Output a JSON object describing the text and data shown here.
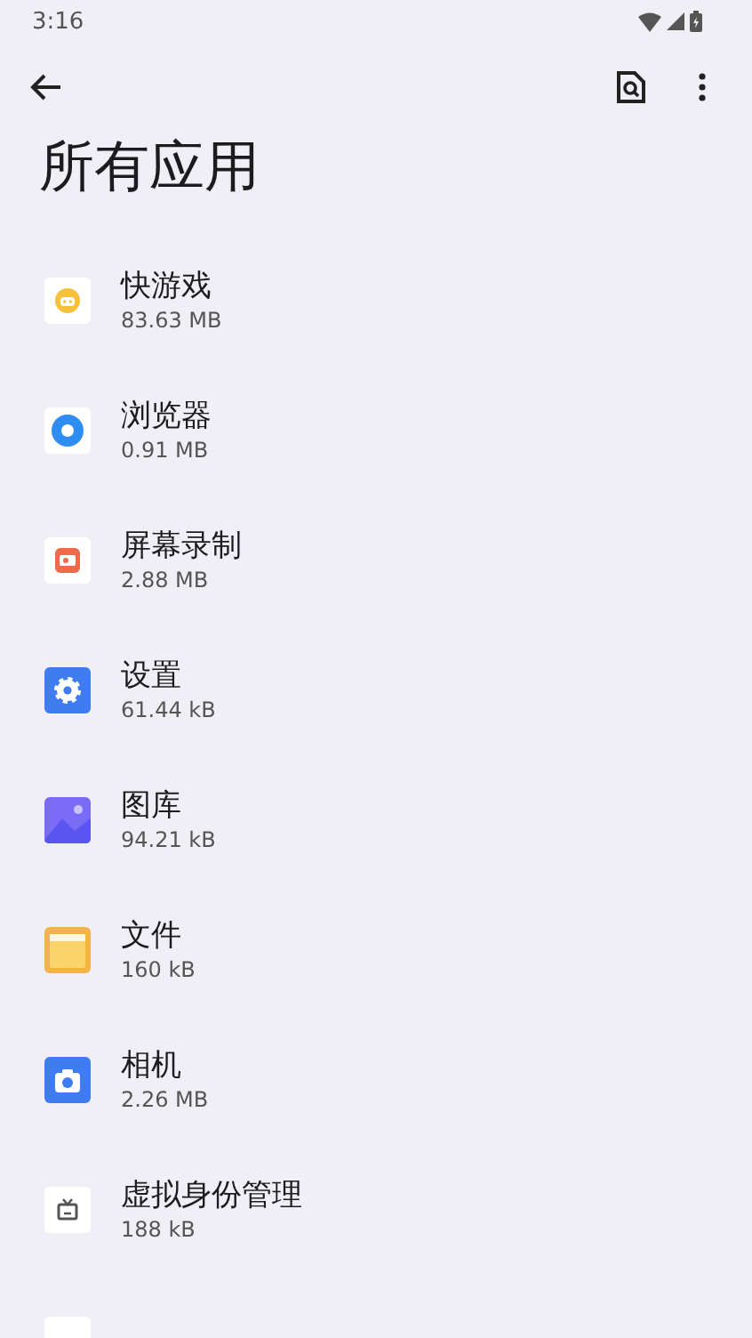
{
  "status_bar": {
    "time": "3:16"
  },
  "toolbar": {
    "title": "所有应用"
  },
  "apps": [
    {
      "name": "快游戏",
      "size": "83.63 MB",
      "kind": "game"
    },
    {
      "name": "浏览器",
      "size": "0.91 MB",
      "kind": "browser"
    },
    {
      "name": "屏幕录制",
      "size": "2.88 MB",
      "kind": "recorder"
    },
    {
      "name": "设置",
      "size": "61.44 kB",
      "kind": "settings"
    },
    {
      "name": "图库",
      "size": "94.21 kB",
      "kind": "gallery"
    },
    {
      "name": "文件",
      "size": "160 kB",
      "kind": "files"
    },
    {
      "name": "相机",
      "size": "2.26 MB",
      "kind": "camera"
    },
    {
      "name": "虚拟身份管理",
      "size": "188 kB",
      "kind": "tv"
    },
    {
      "kind": "blank"
    }
  ]
}
